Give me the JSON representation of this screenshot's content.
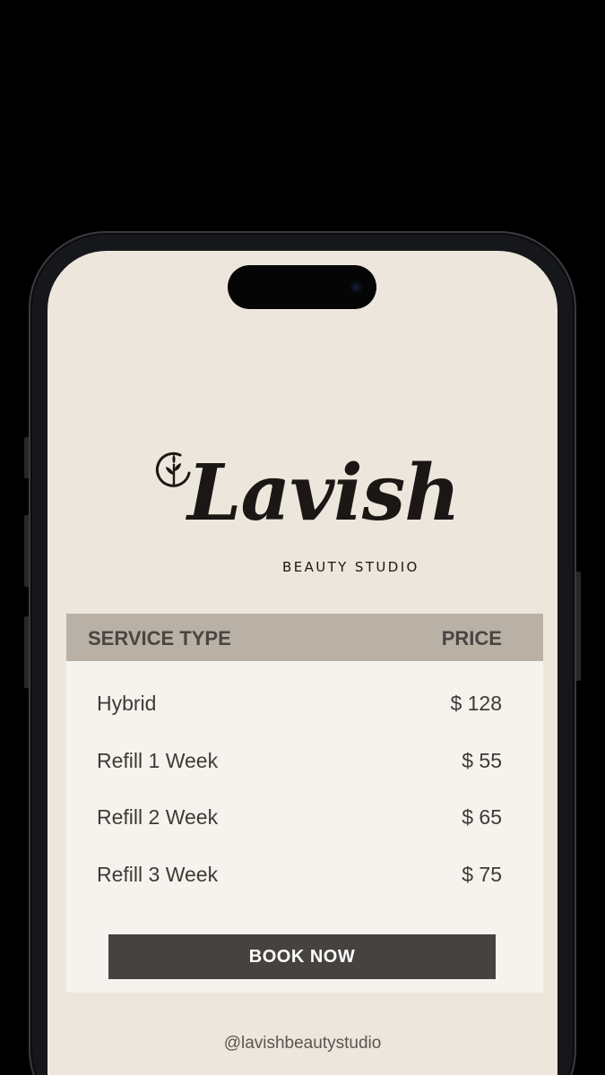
{
  "brand": {
    "name": "Lavish",
    "tagline": "BEAUTY  STUDIO",
    "icon": "leaf-icon"
  },
  "table": {
    "header": {
      "service_label": "SERVICE TYPE",
      "price_label": "PRICE"
    },
    "rows": [
      {
        "service": "Hybrid",
        "price": "$ 128"
      },
      {
        "service": "Refill 1 Week",
        "price": "$ 55"
      },
      {
        "service": "Refill 2 Week",
        "price": "$ 65"
      },
      {
        "service": "Refill 3 Week",
        "price": "$ 75"
      }
    ]
  },
  "actions": {
    "book_label": "BOOK NOW"
  },
  "footer": {
    "handle": "@lavishbeautystudio"
  },
  "colors": {
    "screen_bg": "#ece6dc",
    "header_bg": "#b9b0a6",
    "table_bg": "#f6f3ee",
    "button_bg": "#454240",
    "text_dark": "#3f3a36"
  }
}
